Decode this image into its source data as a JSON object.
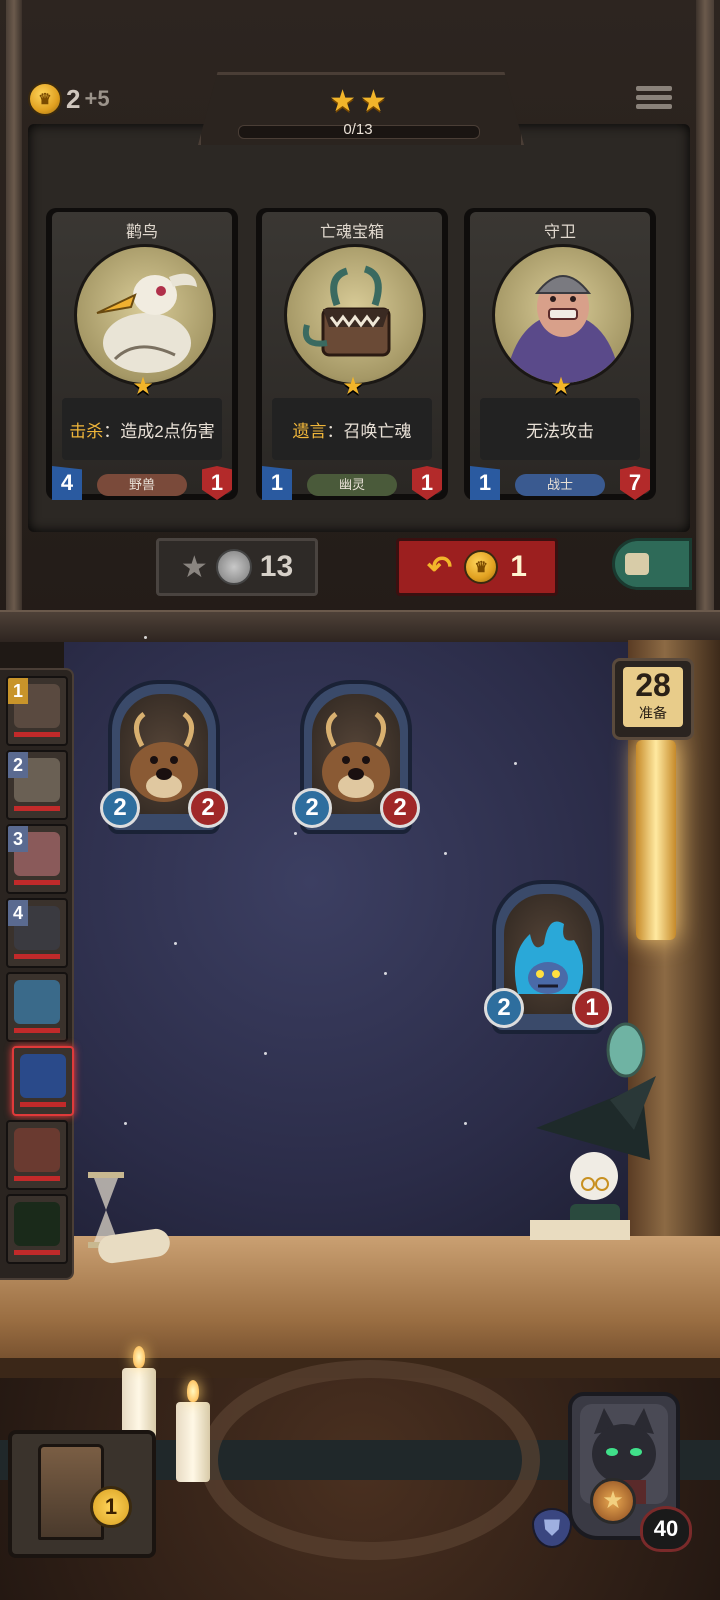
{
  "gold": {
    "value": "2",
    "income": "+5"
  },
  "tier": {
    "stars": "★★",
    "progress": "0/13"
  },
  "shop_cards": [
    {
      "name": "鹳鸟",
      "ability_key": "击杀",
      "ability_text": "：造成2点伤害",
      "tribe": "野兽",
      "attack": "4",
      "health": "1",
      "tribe_color": "#7a4a3a",
      "portrait": "stork"
    },
    {
      "name": "亡魂宝箱",
      "ability_key": "遗言",
      "ability_text": "：召唤亡魂",
      "tribe": "幽灵",
      "attack": "1",
      "health": "1",
      "tribe_color": "#4a5a3a",
      "portrait": "mimic-chest"
    },
    {
      "name": "守卫",
      "ability_key": "",
      "ability_text": "无法攻击",
      "tribe": "战士",
      "attack": "1",
      "health": "7",
      "tribe_color": "#3a5a90",
      "portrait": "guard"
    }
  ],
  "actions": {
    "upgrade_cost": "13",
    "refresh_cost": "1"
  },
  "ready": {
    "count": "28",
    "label": "准备"
  },
  "turn_order": [
    {
      "badge": "1",
      "badge_color": "#c8942a",
      "face_color": "#5a4a40"
    },
    {
      "badge": "2",
      "badge_color": "#5a6a90",
      "face_color": "#6a6054"
    },
    {
      "badge": "3",
      "badge_color": "#5a6a90",
      "face_color": "#8a5a5a"
    },
    {
      "badge": "4",
      "badge_color": "#5a6a90",
      "face_color": "#3a3a40"
    },
    {
      "badge": "",
      "badge_color": "#5a6a90",
      "face_color": "#3a6a8a"
    },
    {
      "badge": "",
      "badge_color": "#5a6a90",
      "face_color": "#2a4a8a"
    },
    {
      "badge": "",
      "badge_color": "#5a6a90",
      "face_color": "#6a3a30"
    },
    {
      "badge": "",
      "badge_color": "#5a6a90",
      "face_color": "#1a2a1a"
    }
  ],
  "board_minions": [
    {
      "type": "deer",
      "attack": "2",
      "health": "2"
    },
    {
      "type": "deer",
      "attack": "2",
      "health": "2"
    },
    {
      "type": "blue-flame-ghost",
      "attack": "2",
      "health": "1"
    }
  ],
  "hero": {
    "health": "40",
    "power_icon": "star-icon"
  },
  "chest": {
    "count": "1"
  }
}
